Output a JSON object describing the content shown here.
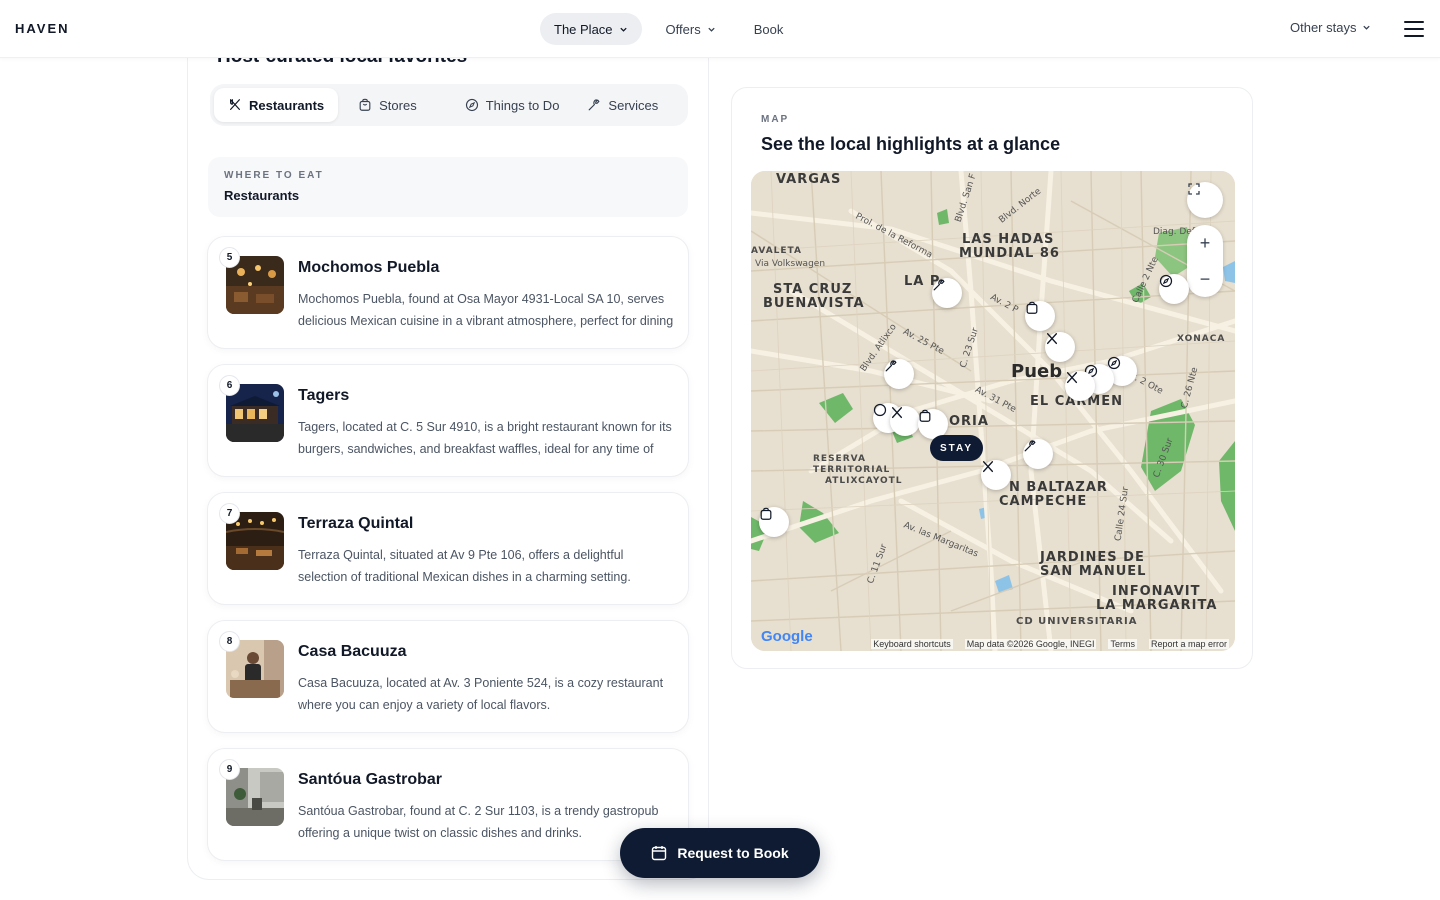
{
  "header": {
    "brand": "HAVEN",
    "nav": [
      {
        "label": "The Place"
      },
      {
        "label": "Offers"
      },
      {
        "label": "Book"
      }
    ],
    "other_stays": "Other stays"
  },
  "left": {
    "title": "Host-curated local favorites",
    "tabs": [
      {
        "label": "Restaurants",
        "icon": "utensils-icon"
      },
      {
        "label": "Stores",
        "icon": "shopping-bag-icon"
      },
      {
        "label": "Things to Do",
        "icon": "compass-icon"
      },
      {
        "label": "Services",
        "icon": "wrench-icon"
      }
    ],
    "section": {
      "eyebrow": "WHERE TO EAT",
      "title": "Restaurants"
    },
    "places": [
      {
        "num": "5",
        "name": "Mochomos Puebla",
        "desc": "Mochomos Puebla, found at Osa Mayor 4931-Local SA 10, serves delicious Mexican cuisine in a vibrant atmosphere, perfect for dining out."
      },
      {
        "num": "6",
        "name": "Tagers",
        "desc": "Tagers, located at C. 5 Sur 4910, is a bright restaurant known for its burgers, sandwiches, and breakfast waffles, ideal for any time of day."
      },
      {
        "num": "7",
        "name": "Terraza Quintal",
        "desc": "Terraza Quintal, situated at Av 9 Pte 106, offers a delightful selection of traditional Mexican dishes in a charming setting."
      },
      {
        "num": "8",
        "name": "Casa Bacuuza",
        "desc": "Casa Bacuuza, located at Av. 3 Poniente 524, is a cozy restaurant where you can enjoy a variety of local flavors."
      },
      {
        "num": "9",
        "name": "Santóua Gastrobar",
        "desc": "Santóua Gastrobar, found at C. 2 Sur 1103, is a trendy gastropub offering a unique twist on classic dishes and drinks."
      }
    ]
  },
  "map": {
    "eyebrow": "MAP",
    "title": "See the local highlights at a glance",
    "stay_label": "STAY",
    "labels": {
      "vargas": "VARGAS",
      "las_hadas": "LAS HADAS",
      "mundial": "MUNDIAL 86",
      "la_paz": "LA P",
      "sta_cruz": "STA CRUZ",
      "buenavista": "BUENAVISTA",
      "avaleta": "AVALETA",
      "via_vw": "Via Volkswagen",
      "puebla": "Pueb",
      "el_carmen": "EL CARMEN",
      "oria": "ORIA",
      "reserva": "RESERVA",
      "territorial": "TERRITORIAL",
      "atlixcayotl": "ATLIXCAYOTL",
      "san_baltazar": "N BALTAZAR",
      "campeche": "CAMPECHE",
      "jardines": "JARDINES DE",
      "san_manuel": "SAN MANUEL",
      "infonavit": "INFONAVIT",
      "la_margarita": "LA MARGARITA",
      "cd_univ": "CD UNIVERSITARIA",
      "xonaca": "XONACA",
      "diag": "Diag. Defe",
      "prol_reforma": "Prol. de la Reforma",
      "blvd_norte": "Blvd. Norte",
      "blvd_sanf": "Blvd. San F",
      "av25": "Av. 25 Pte",
      "av31": "Av. 31 Pte",
      "av2": "Av. 2 P",
      "blvd_atlixco": "Blvd. Atlixco",
      "c23sur": "C. 23 Sur",
      "las_margaritas": "Av. las Margaritas",
      "c11sur": "C. 11 Sur",
      "c24sur": "Calle 24 Sur",
      "c30sur": "C. 30 Sur",
      "c26nte": "C. 26 Nte",
      "c2nte": "Calle 2 Nte",
      "v2ote": "v. 2 Ote"
    },
    "footer": {
      "google": "Google",
      "shortcuts": "Keyboard shortcuts",
      "data": "Map data ©2026 Google, INEGI",
      "terms": "Terms",
      "report": "Report a map error"
    }
  },
  "cta": {
    "label": "Request to Book"
  },
  "colors": {
    "primary": "#0f1b33",
    "map_bg": "#e7dfcf",
    "park": "#6fb86a"
  }
}
